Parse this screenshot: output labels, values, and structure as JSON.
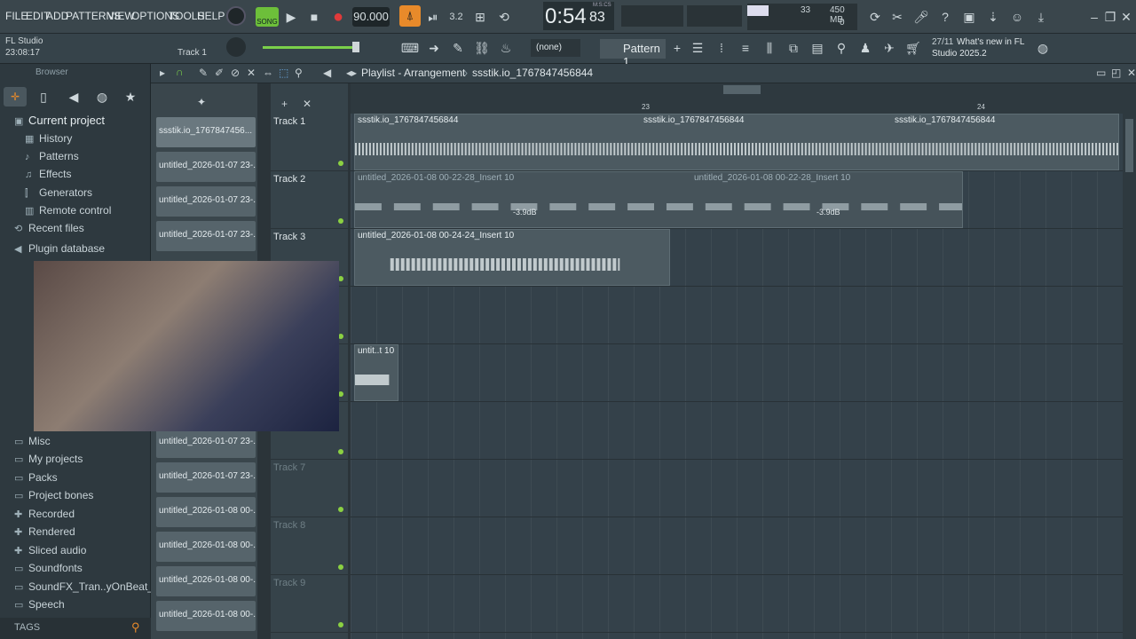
{
  "menu": [
    "FILE",
    "EDIT",
    "ADD",
    "PATTERNS",
    "VIEW",
    "OPTIONS",
    "TOOLS",
    "HELP"
  ],
  "transport": {
    "mode": "SONG",
    "tempo": "90.000",
    "time_main": "0:54",
    "time_sub": "83",
    "time_label": "M:S:CS"
  },
  "meters": {
    "cpu": "33",
    "mem": "450 MB",
    "poly": "0"
  },
  "project": {
    "name": "FL Studio",
    "time": "23:08:17",
    "track": "Track 1"
  },
  "toolbar2": {
    "pattern_none": "(none)",
    "pattern": "Pattern 1"
  },
  "news": {
    "date": "27/11",
    "text1": "What's new in FL",
    "text2": "Studio 2025.2"
  },
  "browser": {
    "title": "Browser",
    "items": [
      "Current project",
      "History",
      "Patterns",
      "Effects",
      "Generators",
      "Remote control",
      "Recent files",
      "Plugin database",
      "Misc",
      "My projects",
      "Packs",
      "Project bones",
      "Recorded",
      "Rendered",
      "Sliced audio",
      "Soundfonts",
      "SoundFX_Tran..yOnBeat_com",
      "Speech"
    ],
    "tags": "TAGS"
  },
  "playlist": {
    "title": "Playlist - Arrangement",
    "crumb": "ssstik.io_1767847456844",
    "bar23": "23",
    "bar24": "24"
  },
  "cliplist": [
    "ssstik.io_1767847456...",
    "untitled_2026-01-07 23-...",
    "untitled_2026-01-07 23-...",
    "untitled_2026-01-07 23-...",
    "untitled_2026-01-07 23-...",
    "untitled_2026-01-07 23-...",
    "untitled_2026-01-08 00-...",
    "untitled_2026-01-08 00-...",
    "untitled_2026-01-08 00-...",
    "untitled_2026-01-08 00-..."
  ],
  "tracks": [
    "Track 1",
    "Track 2",
    "Track 3",
    "",
    "",
    "",
    "Track 7",
    "Track 8",
    "Track 9"
  ],
  "clips": {
    "t1a": "ssstik.io_1767847456844",
    "t1b": "ssstik.io_1767847456844",
    "t1c": "ssstik.io_1767847456844",
    "t2a": "untitled_2026-01-08 00-22-28_Insert 10",
    "t2b": "untitled_2026-01-08 00-22-28_Insert 10",
    "t3": "untitled_2026-01-08 00-24-24_Insert 10",
    "t5": "untit..t 10",
    "db1": "-3.9dB",
    "db2": "-3.9dB"
  }
}
